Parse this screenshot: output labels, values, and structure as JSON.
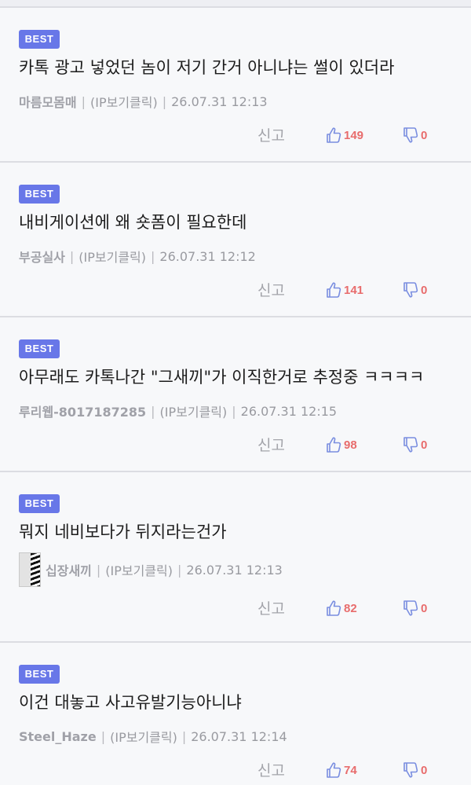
{
  "comments": [
    {
      "badge": "BEST",
      "text": "카톡 광고 넣었던 놈이 저기 간거 아니냐는 썰이 있더라",
      "author": "마름모몸매",
      "ip": "(IP보기클릭)",
      "time": "26.07.31 12:13",
      "report": "신고",
      "likes": "149",
      "dislikes": "0"
    },
    {
      "badge": "BEST",
      "text": "내비게이션에 왜 숏폼이 필요한데",
      "author": "부공실사",
      "ip": "(IP보기클릭)",
      "time": "26.07.31 12:12",
      "report": "신고",
      "likes": "141",
      "dislikes": "0"
    },
    {
      "badge": "BEST",
      "text": "아무래도 카톡나간 \"그새끼\"가 이직한거로 추정중 ㅋㅋㅋㅋ",
      "author": "루리웹-8017187285",
      "ip": "(IP보기클릭)",
      "time": "26.07.31 12:15",
      "report": "신고",
      "likes": "98",
      "dislikes": "0"
    },
    {
      "badge": "BEST",
      "text": "뭐지 네비보다가 뒤지라는건가",
      "author": "십장새끼",
      "ip": "(IP보기클릭)",
      "time": "26.07.31 12:13",
      "report": "신고",
      "likes": "82",
      "dislikes": "0"
    },
    {
      "badge": "BEST",
      "text": "이건 대놓고 사고유발기능아니냐",
      "author": "Steel_Haze",
      "ip": "(IP보기클릭)",
      "time": "26.07.31 12:14",
      "report": "신고",
      "likes": "74",
      "dislikes": "0"
    }
  ],
  "separator": "|",
  "colors": {
    "badge": "#6877e8",
    "count": "#e86c6c",
    "thumb": "#7a8ee0",
    "background": "#f7f8fa"
  },
  "icons": {
    "like": "thumbs-up-icon",
    "dislike": "thumbs-down-icon"
  }
}
